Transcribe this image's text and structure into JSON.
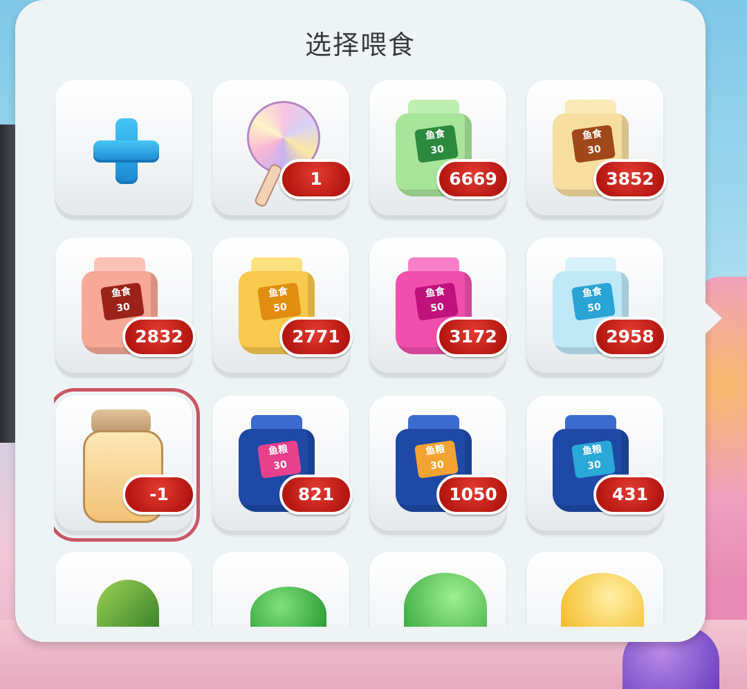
{
  "title": "选择喂食",
  "items": [
    {
      "name": "add",
      "badge": ""
    },
    {
      "name": "lollipop",
      "badge": "1"
    },
    {
      "name": "fish-food-green-30",
      "label": "鱼食\n30",
      "badge": "6669",
      "color": "#a8e49a"
    },
    {
      "name": "fish-food-cream-30",
      "label": "鱼食\n30",
      "badge": "3852",
      "color": "#f6dea0"
    },
    {
      "name": "fish-food-peach-30",
      "label": "鱼食\n30",
      "badge": "2832",
      "color": "#f7a897"
    },
    {
      "name": "fish-food-gold-50",
      "label": "鱼食\n50",
      "badge": "2771",
      "color": "#f8c94d"
    },
    {
      "name": "fish-food-pink-50",
      "label": "鱼食\n50",
      "badge": "3172",
      "color": "#f04fae"
    },
    {
      "name": "fish-food-ice-50",
      "label": "鱼食\n50",
      "badge": "2958",
      "color": "#bfe8f7"
    },
    {
      "name": "jar",
      "badge": "-1",
      "selected": true
    },
    {
      "name": "fish-grain-blue-30-pink",
      "label": "鱼粮\n30",
      "badge": "821",
      "color": "#1e49a6"
    },
    {
      "name": "fish-grain-blue-30-orange",
      "label": "鱼粮\n30",
      "badge": "1050",
      "color": "#1e49a6"
    },
    {
      "name": "fish-grain-blue-30-cyan",
      "label": "鱼粮\n30",
      "badge": "431",
      "color": "#1e49a6"
    },
    {
      "name": "sprout",
      "badge": ""
    },
    {
      "name": "green-slime",
      "badge": ""
    },
    {
      "name": "green-drop",
      "badge": ""
    },
    {
      "name": "yellow-drop",
      "badge": ""
    }
  ]
}
